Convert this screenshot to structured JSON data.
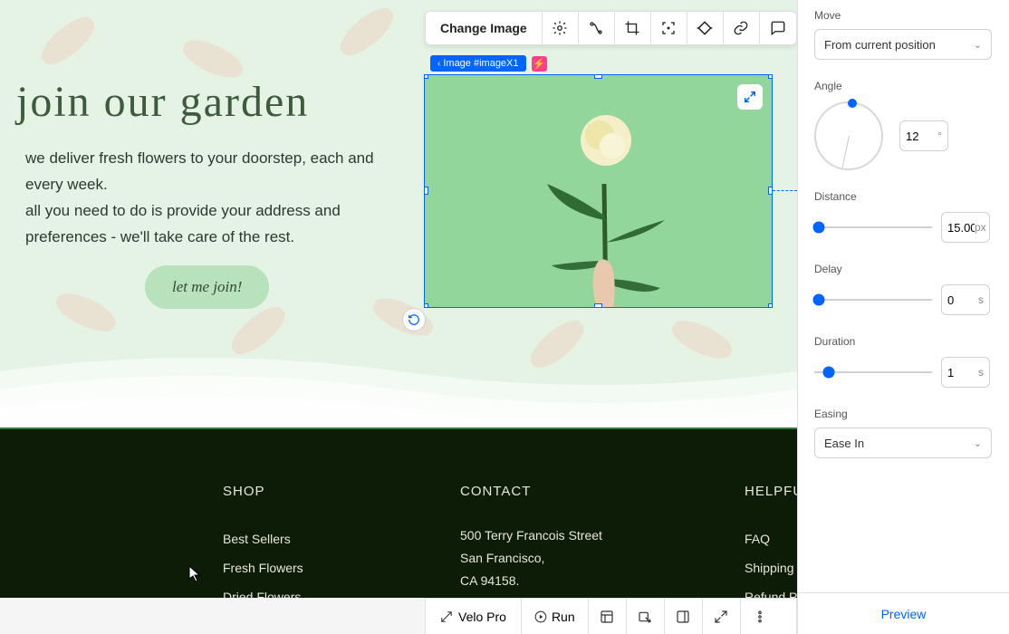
{
  "hero": {
    "title": "join our garden",
    "body": "we deliver fresh flowers to your doorstep, each and every week.\nall you need to do is provide your address and preferences - we'll take care of the rest.",
    "cta": "let me join!"
  },
  "image_toolbar": {
    "change": "Change Image",
    "icons": [
      "settings-gear-icon",
      "transform-icon",
      "crop-icon",
      "focus-icon",
      "shape-icon",
      "link-icon",
      "comment-icon"
    ]
  },
  "image_chip": {
    "label": "Image #imageX1",
    "highlight": "bolt-icon"
  },
  "undo_icon": "undo-icon",
  "expand_icon": "expand-icon",
  "footer": {
    "shop": {
      "title": "SHOP",
      "items": [
        "Best Sellers",
        "Fresh Flowers",
        "Dried Flowers"
      ]
    },
    "contact": {
      "title": "CONTACT",
      "lines": [
        "500 Terry Francois Street",
        "San Francisco,",
        "CA 94158."
      ]
    },
    "help": {
      "title": "HELPFU",
      "items": [
        "FAQ",
        "Shipping",
        "Refund P"
      ]
    }
  },
  "panel": {
    "move": {
      "label": "Move",
      "value": "From current position"
    },
    "angle": {
      "label": "Angle",
      "value": "12",
      "unit": "°"
    },
    "distance": {
      "label": "Distance",
      "value": "15.00",
      "unit": "px",
      "thumb_pct": 4
    },
    "delay": {
      "label": "Delay",
      "value": "0",
      "unit": "s",
      "thumb_pct": 4
    },
    "duration": {
      "label": "Duration",
      "value": "1",
      "unit": "s",
      "thumb_pct": 12
    },
    "easing": {
      "label": "Easing",
      "value": "Ease In"
    },
    "preview": "Preview"
  },
  "devbar": {
    "velo": "Velo Pro",
    "run": "Run",
    "icons": [
      "layout-icon",
      "inspect-icon",
      "panel-icon",
      "expand-icon",
      "more-icon"
    ]
  }
}
